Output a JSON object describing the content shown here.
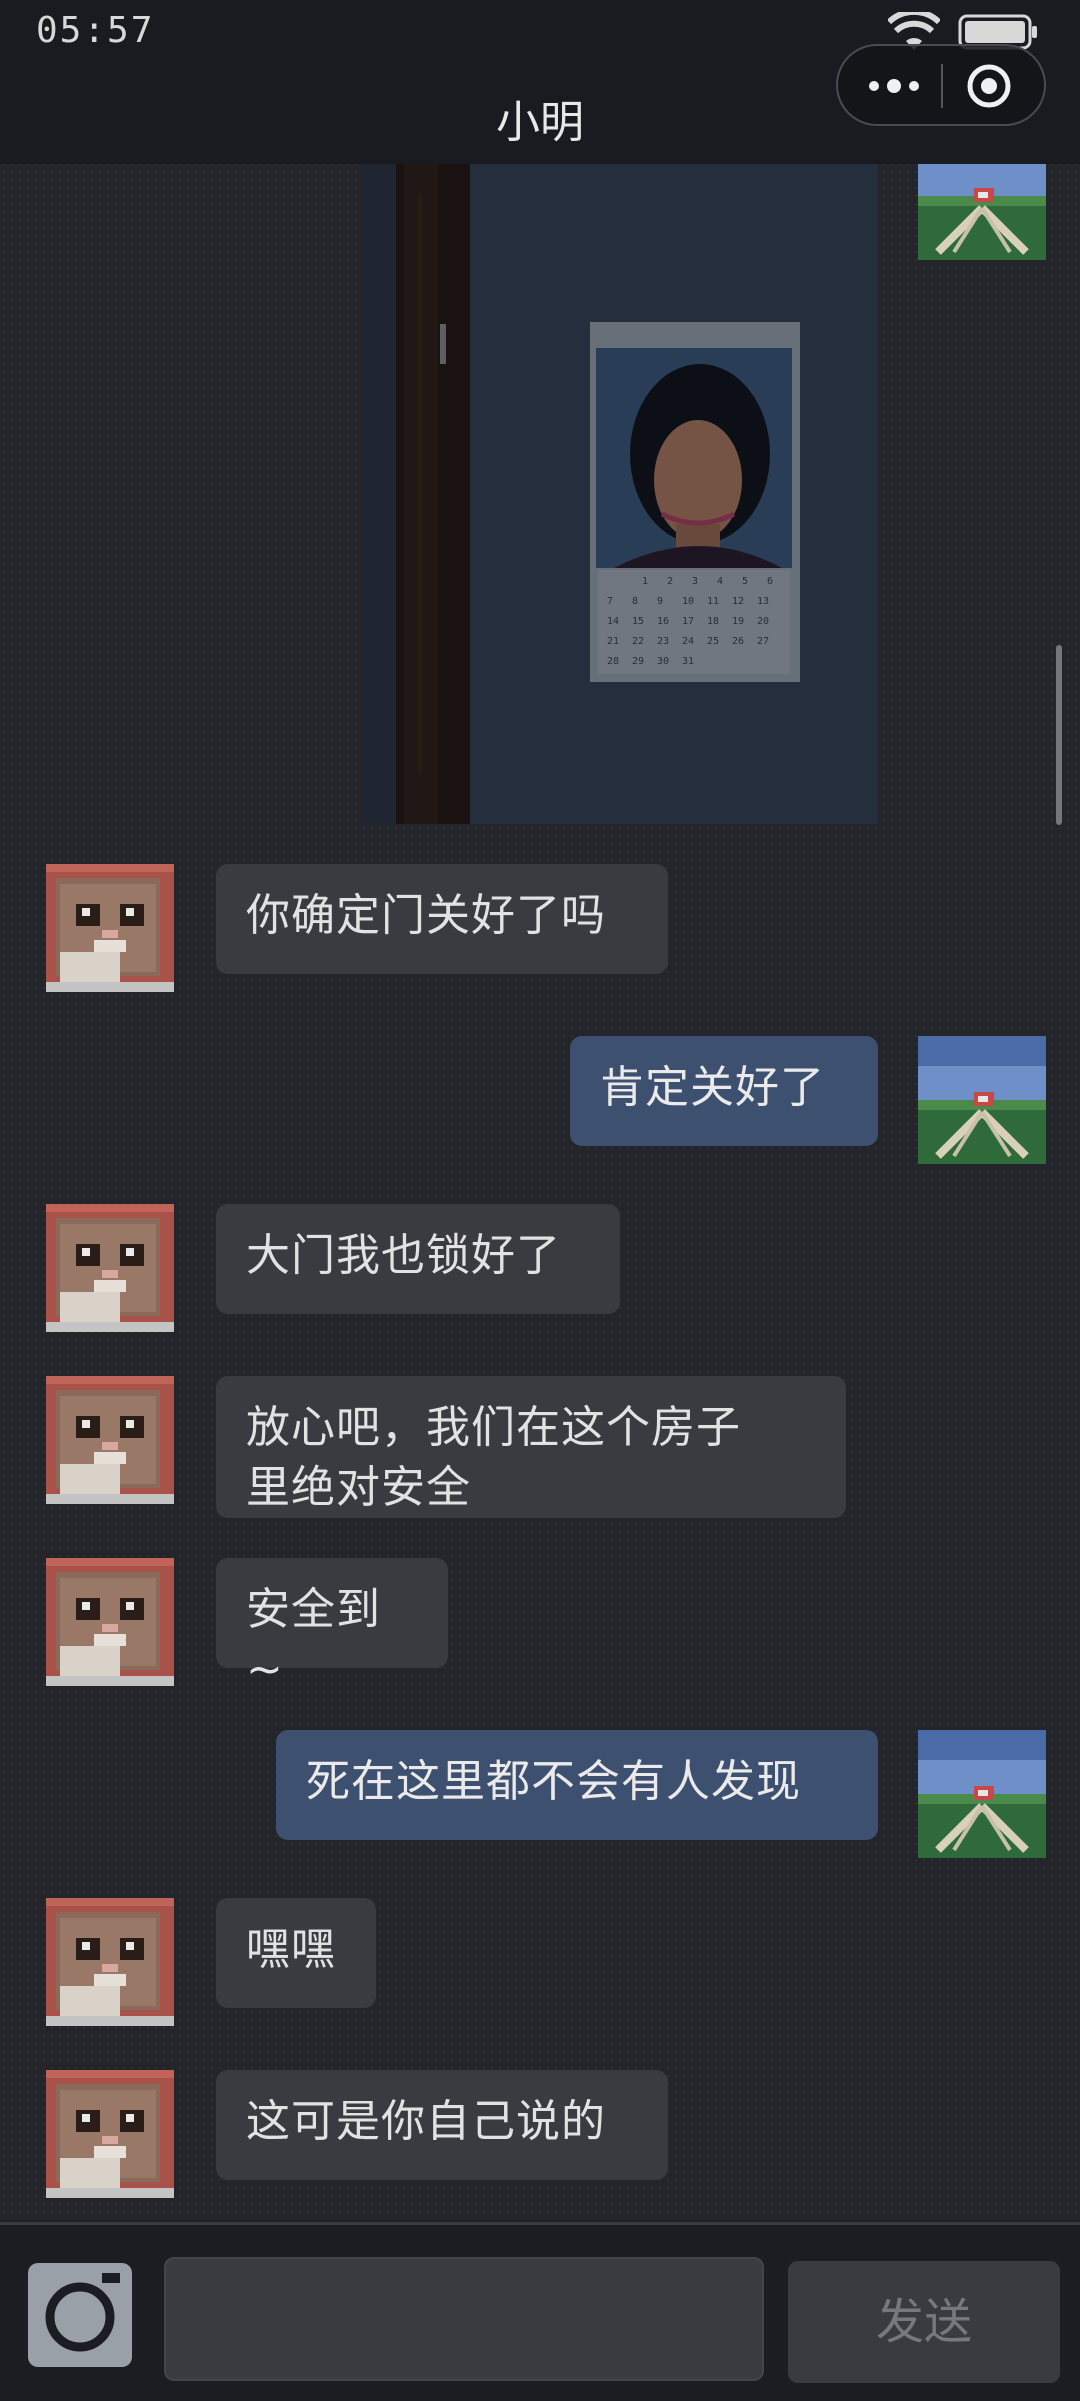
{
  "status_bar": {
    "time": "05:57",
    "icons": [
      "wifi-icon",
      "battery-icon"
    ]
  },
  "header": {
    "title": "小明",
    "capsule_icons": [
      "more-icon",
      "target-icon"
    ]
  },
  "chat": {
    "messages": [
      {
        "side": "in",
        "text": "你确定门关好了吗"
      },
      {
        "side": "out",
        "text": "肯定关好了"
      },
      {
        "side": "in",
        "text": "大门我也锁好了"
      },
      {
        "side": "in",
        "text": "放心吧，我们在这个房子\n里绝对安全"
      },
      {
        "side": "in",
        "text": "安全到~"
      },
      {
        "side": "out",
        "text": "死在这里都不会有人发现"
      },
      {
        "side": "in",
        "text": "嘿嘿"
      },
      {
        "side": "in",
        "text": "这可是你自己说的"
      }
    ]
  },
  "photo_calendar": {
    "numbers": [
      "1",
      "2",
      "3",
      "4",
      "5",
      "6",
      "7",
      "8",
      "9",
      "10",
      "11",
      "12",
      "13",
      "14",
      "15",
      "16",
      "17",
      "18",
      "19",
      "20",
      "21",
      "22",
      "23",
      "24",
      "25",
      "26",
      "27",
      "28",
      "29",
      "30",
      "31"
    ]
  },
  "input_bar": {
    "send_label": "发送",
    "camera_icon": "camera-icon"
  },
  "colors": {
    "incoming_bubble": "#3a3b41",
    "outgoing_bubble": "#3e5070",
    "background": "#23252b"
  }
}
